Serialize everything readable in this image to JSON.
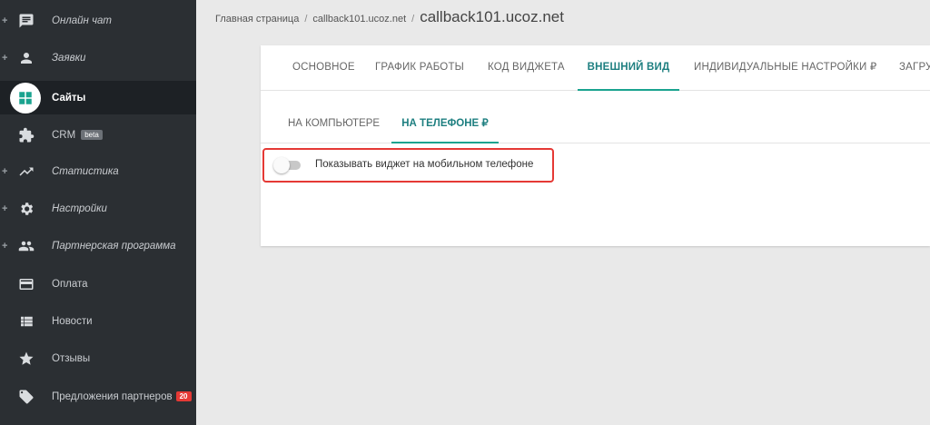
{
  "sidebar": {
    "items": [
      {
        "label": "Онлайн чат",
        "icon": "chat-icon",
        "expandable": true,
        "italic": true
      },
      {
        "label": "Заявки",
        "icon": "person-icon",
        "expandable": true,
        "italic": true
      },
      {
        "label": "Сайты",
        "icon": "sites-icon",
        "active": true
      },
      {
        "label": "CRM",
        "icon": "crm-icon",
        "badge": "beta"
      },
      {
        "label": "Статистика",
        "icon": "trending-up-icon",
        "expandable": true,
        "italic": true
      },
      {
        "label": "Настройки",
        "icon": "gear-icon",
        "expandable": true,
        "italic": true
      },
      {
        "label": "Партнерская программа",
        "icon": "people-icon",
        "expandable": true,
        "italic": true
      },
      {
        "label": "Оплата",
        "icon": "credit-card-icon"
      },
      {
        "label": "Новости",
        "icon": "list-icon"
      },
      {
        "label": "Отзывы",
        "icon": "star-icon"
      },
      {
        "label": "Предложения партнеров",
        "icon": "tag-icon",
        "count": "20"
      }
    ],
    "plus_symbol": "+"
  },
  "breadcrumb": {
    "home": "Главная страница",
    "site": "callback101.ucoz.net",
    "current": "callback101.ucoz.net",
    "separator": "/"
  },
  "tabs": [
    {
      "label": "ОСНОВНОЕ"
    },
    {
      "label": "ГРАФИК РАБОТЫ"
    },
    {
      "label": "КОД ВИДЖЕТА"
    },
    {
      "label": "ВНЕШНИЙ ВИД",
      "active": true
    },
    {
      "label": "ИНДИВИДУАЛЬНЫЕ НАСТРОЙКИ ₽"
    },
    {
      "label": "ЗАГРУ"
    }
  ],
  "subtabs": [
    {
      "label": "НА КОМПЬЮТЕРЕ"
    },
    {
      "label": "НА ТЕЛЕФОНЕ ₽",
      "active": true
    }
  ],
  "toggle": {
    "label": "Показывать виджет на мобильном телефоне",
    "checked": false
  },
  "colors": {
    "sidebar_bg": "#2b2f33",
    "accent": "#1aa38f",
    "highlight_border": "#e53935"
  }
}
